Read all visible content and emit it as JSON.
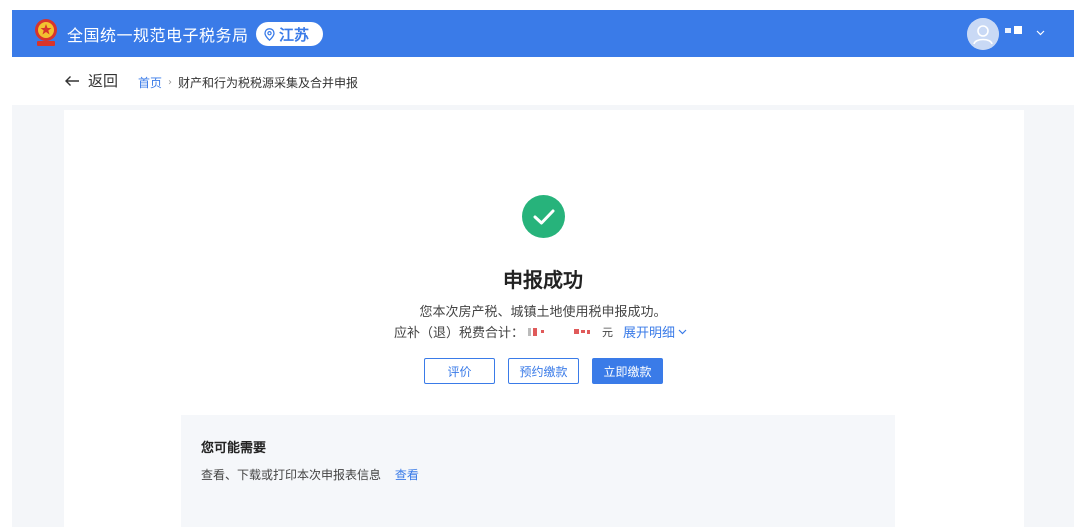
{
  "header": {
    "site_title": "全国统一规范电子税务局",
    "region": "江苏",
    "bg_color": "#3a7be8"
  },
  "icons": {
    "emblem": "national-emblem-icon",
    "region": "location-pin-icon",
    "avatar": "user-avatar-icon",
    "user_menu": "chevron-down-icon",
    "back": "arrow-left-icon",
    "success": "check-circle-icon",
    "expand": "chevron-down-icon"
  },
  "nav": {
    "back_label": "返回",
    "breadcrumb_home": "首页",
    "breadcrumb_separator": "›",
    "breadcrumb_current": "财产和行为税税源采集及合并申报"
  },
  "result": {
    "title": "申报成功",
    "description": "您本次房产税、城镇土地使用税申报成功。",
    "amount_label": "应补（退）税费合计：",
    "amount_unit": "元",
    "expand_label": "展开明细",
    "success_color": "#27b37b"
  },
  "actions": {
    "rate_label": "评价",
    "schedule_label": "预约缴款",
    "pay_label": "立即缴款"
  },
  "suggestions": {
    "title": "您可能需要",
    "item_text": "查看、下载或打印本次申报表信息",
    "item_link": "查看"
  }
}
